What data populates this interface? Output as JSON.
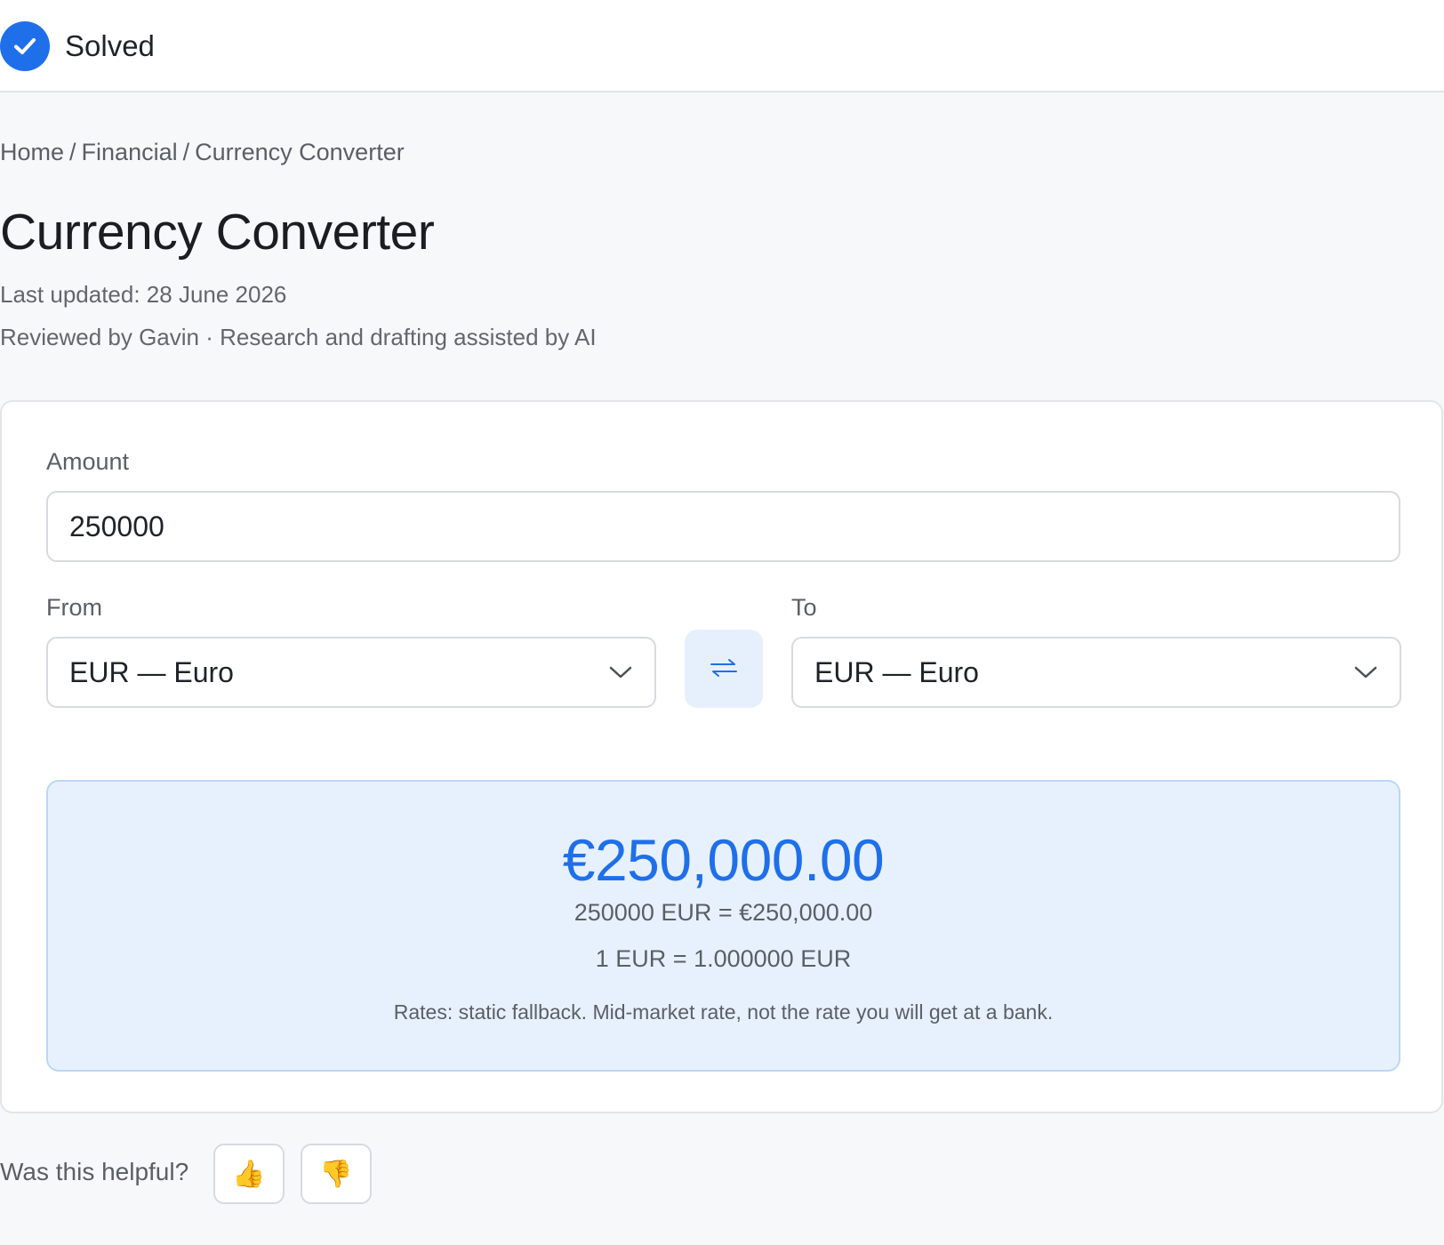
{
  "status": {
    "label": "Solved",
    "icon": "check-circle-icon",
    "color": "#1f6fea"
  },
  "breadcrumb": [
    "Home",
    "Financial",
    "Currency Converter"
  ],
  "page": {
    "title": "Currency Converter",
    "last_updated": "Last updated: 28 June 2026",
    "reviewed": "Reviewed by Gavin · Research and drafting assisted by AI"
  },
  "form": {
    "amount_label": "Amount",
    "amount_value": "250000",
    "from_label": "From",
    "from_value": "EUR — Euro",
    "to_label": "To",
    "to_value": "EUR — Euro",
    "swap_icon": "swap-arrows-icon",
    "dropdown_icon": "chevron-down-icon"
  },
  "result": {
    "converted": "€250,000.00",
    "equation": "250000 EUR = €250,000.00",
    "rate": "1 EUR = 1.000000 EUR",
    "note": "Rates: static fallback. Mid-market rate, not the rate you will get at a bank."
  },
  "feedback": {
    "question": "Was this helpful?",
    "up_glyph": "👍",
    "down_glyph": "👎"
  },
  "colors": {
    "accent": "#1f6fea",
    "result_bg": "#e7f1fd",
    "page_bg": "#f7f8fa"
  }
}
